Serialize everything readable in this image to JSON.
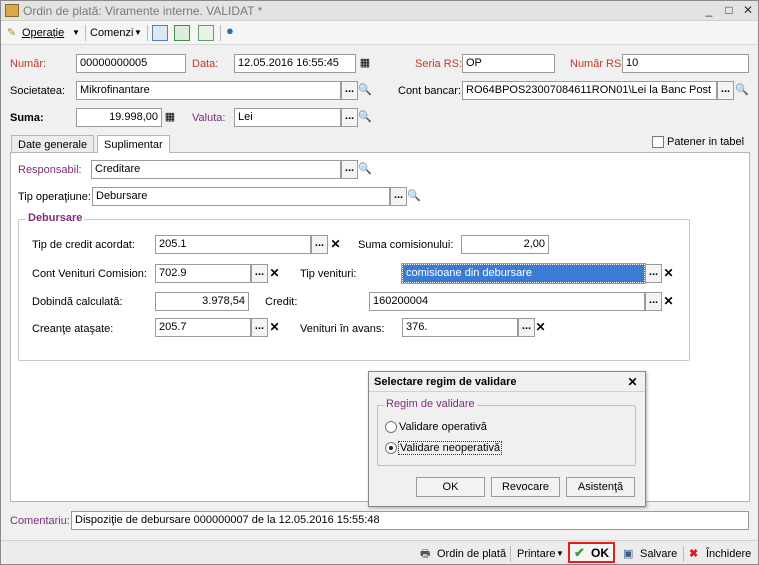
{
  "window": {
    "title": "Ordin de plată: Viramente interne. VALIDAT *",
    "min": "_",
    "max": "□",
    "close": "✕"
  },
  "toolbar": {
    "operatie": "Operaţie",
    "comenzi": "Comenzi"
  },
  "header": {
    "numar_label": "Număr:",
    "numar_value": "00000000005",
    "data_label": "Data:",
    "data_value": "12.05.2016 16:55:45",
    "seria_label": "Seria RS:",
    "seria_value": "OP",
    "numar_rs_label": "Număr RS:",
    "numar_rs_value": "10",
    "societatea_label": "Societatea:",
    "societatea_value": "Mikrofinantare",
    "cont_bancar_label": "Cont bancar:",
    "cont_bancar_value": "RO64BPOS23007084611RON01\\Lei la Banc Post",
    "suma_label": "Suma:",
    "suma_value": "19.998,00",
    "valuta_label": "Valuta:",
    "valuta_value": "Lei"
  },
  "tabs": [
    {
      "label": "Date generale"
    },
    {
      "label": "Suplimentar"
    }
  ],
  "patener_label": "Patener in tabel",
  "panel": {
    "responsabil_label": "Responsabil:",
    "responsabil_value": "Creditare",
    "tip_operatiune_label": "Tip operaţiune:",
    "tip_operatiune_value": "Debursare",
    "debursare_title": "Debursare",
    "tip_credit_label": "Tip de credit acordat:",
    "tip_credit_value": "205.1",
    "suma_comision_label": "Suma comisionului:",
    "suma_comision_value": "2,00",
    "cont_venituri_label": "Cont Venituri Comision:",
    "cont_venituri_value": "702.9",
    "tip_venituri_label": "Tip venituri:",
    "tip_venituri_value": "comisioane din debursare",
    "dobanda_label": "Dobindă calculată:",
    "dobanda_value": "3.978,54",
    "credit_label": "Credit:",
    "credit_value": "160200004",
    "creante_label": "Creanţe ataşate:",
    "creante_value": "205.7",
    "venituri_avans_label": "Venituri în avans:",
    "venituri_avans_value": "376."
  },
  "dialog": {
    "title": "Selectare regim de validare",
    "group_title": "Regim de validare",
    "option1": "Validare operativă",
    "option2": "Validare neoperativă",
    "selected": "Validare neoperativă",
    "ok": "OK",
    "revocare": "Revocare",
    "asistenta": "Asistenţă"
  },
  "comentariu_label": "Comentariu:",
  "comentariu_value": "Dispoziţie de debursare 000000007 de la 12.05.2016 15:55:48",
  "bottom": {
    "ordin": "Ordin de plată",
    "printare": "Printare",
    "ok": "OK",
    "salvare": "Salvare",
    "inchidere": "Închidere"
  }
}
